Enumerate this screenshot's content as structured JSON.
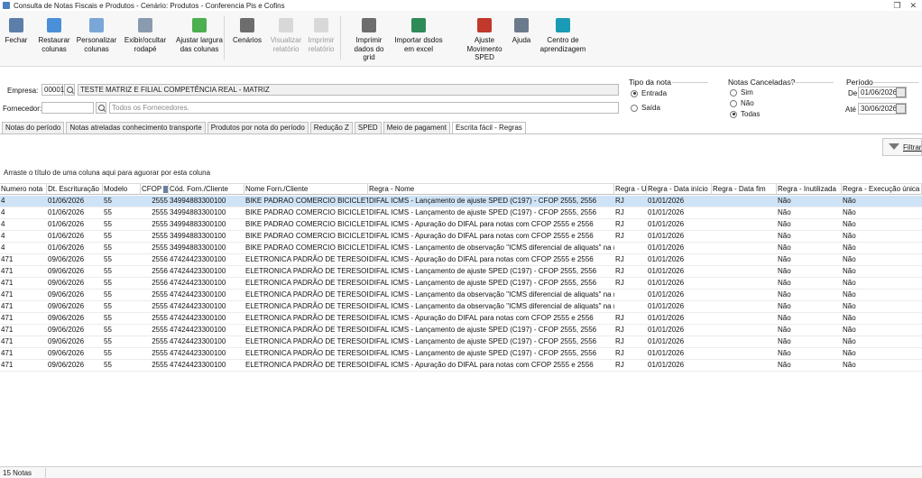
{
  "window": {
    "title": "Consulta de Notas Fiscais e Produtos - Cenário: Produtos - Conferencia Pis e Cofins"
  },
  "toolbar": {
    "buttons": [
      {
        "label": "Fechar",
        "icon": "exit-icon",
        "color": "#5b7fa8"
      },
      {
        "label": "Restaurar\ncolunas",
        "icon": "restore-columns-icon",
        "color": "#4a90d9"
      },
      {
        "label": "Personalizar\ncolunas",
        "icon": "customize-columns-icon",
        "color": "#7aa7d8"
      },
      {
        "label": "Exibir/ocultar\nrodapé",
        "icon": "footer-toggle-icon",
        "color": "#8a9bb0"
      },
      {
        "label": "Ajustar largura\ndas colunas",
        "icon": "column-width-icon",
        "color": "#4caf50"
      },
      {
        "label": "Cenários",
        "icon": "scenarios-icon",
        "color": "#6d6d6d"
      },
      {
        "label": "Visualizar\nrelatório",
        "icon": "preview-report-icon",
        "color": "#9e9e9e"
      },
      {
        "label": "Imprimir\nrelatório",
        "icon": "print-report-icon",
        "color": "#9e9e9e"
      },
      {
        "label": "Imprimir\ndados do grid",
        "icon": "print-grid-icon",
        "color": "#6d6d6d"
      },
      {
        "label": "Importar dsdos\nem excel",
        "icon": "excel-import-icon",
        "color": "#2e8b57"
      },
      {
        "label": "Ajuste\nMovimento SPED",
        "icon": "sped-adjust-icon",
        "color": "#c0392b"
      },
      {
        "label": "Ajuda",
        "icon": "help-icon",
        "color": "#6b7b8c"
      },
      {
        "label": "Centro de\naprendizagem",
        "icon": "learning-center-icon",
        "color": "#1a9bb5"
      }
    ]
  },
  "filters": {
    "empresa_label": "Empresa:",
    "empresa_code": "00001",
    "empresa_name": "TESTE MATRIZ E FILIAL COMPETÊNCIA REAL - MATRIZ",
    "fornecedor_label": "Fornecedor:",
    "fornecedor_code": "",
    "fornecedor_placeholder": "Todos os Fornecedores.",
    "tipo_nota": {
      "title": "Tipo da nota",
      "options": [
        "Entrada",
        "Saída"
      ],
      "selected": "Entrada"
    },
    "notas_canceladas": {
      "title": "Notas Canceladas?",
      "options": [
        "Sim",
        "Não",
        "Todas"
      ],
      "selected": "Todas"
    },
    "periodo": {
      "title": "Período",
      "de_label": "De",
      "de_value": "01/06/2026",
      "ate_label": "Até",
      "ate_value": "30/06/2026"
    }
  },
  "tabs": [
    {
      "label": "Notas do período",
      "active": false
    },
    {
      "label": "Notas atreladas conhecimento transporte",
      "active": false
    },
    {
      "label": "Produtos por nota do período",
      "active": false
    },
    {
      "label": "Redução Z",
      "active": false
    },
    {
      "label": "SPED",
      "active": false
    },
    {
      "label": "Meio de pagament",
      "active": false
    },
    {
      "label": "Escrita fácil - Regras",
      "active": true
    }
  ],
  "filter_button": "Filtrar",
  "group_hint": "Arraste o título de uma coluna aqui para aguorar por esta coluna",
  "grid": {
    "columns": [
      "Numero nota",
      "Dt. Escrituração",
      "Modelo",
      "CFOP",
      "Cód. Forn./Cliente",
      "Nome Forn./Cliente",
      "Regra - Nome",
      "Regra - UF",
      "Regra - Data início",
      "Regra - Data fim",
      "Regra - Inutilizada",
      "Regra - Execução única"
    ],
    "rows": [
      [
        "4",
        "01/06/2026",
        "55",
        "2555",
        "34994883300100",
        "BIKE PADRAO COMERCIO BICICLETAS LTDA",
        "DIFAL ICMS - Lançamento de ajuste SPED (C197) - CFOP 2555, 2556",
        "RJ",
        "01/01/2026",
        "",
        "Não",
        "Não"
      ],
      [
        "4",
        "01/06/2026",
        "55",
        "2555",
        "34994883300100",
        "BIKE PADRAO COMERCIO BICICLETAS LTDA",
        "DIFAL ICMS - Lançamento de ajuste SPED (C197) - CFOP 2555, 2556",
        "RJ",
        "01/01/2026",
        "",
        "Não",
        "Não"
      ],
      [
        "4",
        "01/06/2026",
        "55",
        "2555",
        "34994883300100",
        "BIKE PADRAO COMERCIO BICICLETAS LTDA",
        "DIFAL ICMS - Apuração do DIFAL para notas com CFOP 2555 e 2556",
        "RJ",
        "01/01/2026",
        "",
        "Não",
        "Não"
      ],
      [
        "4",
        "01/06/2026",
        "55",
        "2555",
        "34994883300100",
        "BIKE PADRAO COMERCIO BICICLETAS LTDA",
        "DIFAL ICMS - Apuração do DIFAL para notas com CFOP 2555 e 2556",
        "RJ",
        "01/01/2026",
        "",
        "Não",
        "Não"
      ],
      [
        "4",
        "01/06/2026",
        "55",
        "2555",
        "34994883300100",
        "BIKE PADRAO COMERCIO BICICLETAS LTDA",
        "DIFAL ICMS - Lançamento de observação \"ICMS diferencial de aliquats\" na nota",
        "",
        "01/01/2026",
        "",
        "Não",
        "Não"
      ],
      [
        "471",
        "09/06/2026",
        "55",
        "2556",
        "47424423300100",
        "ELETRONICA PADRÃO DE TERESOPOLIS LTDA",
        "DIFAL ICMS - Apuração do DIFAL para notas com CFOP 2555 e 2556",
        "RJ",
        "01/01/2026",
        "",
        "Não",
        "Não"
      ],
      [
        "471",
        "09/06/2026",
        "55",
        "2556",
        "47424423300100",
        "ELETRONICA PADRÃO DE TERESOPOLIS LTDA",
        "DIFAL ICMS - Lançamento de ajuste SPED (C197) - CFOP 2555, 2556",
        "RJ",
        "01/01/2026",
        "",
        "Não",
        "Não"
      ],
      [
        "471",
        "09/06/2026",
        "55",
        "2556",
        "47424423300100",
        "ELETRONICA PADRÃO DE TERESOPOLIS LTDA",
        "DIFAL ICMS - Lançamento de ajuste SPED (C197) - CFOP 2555, 2556",
        "RJ",
        "01/01/2026",
        "",
        "Não",
        "Não"
      ],
      [
        "471",
        "09/06/2026",
        "55",
        "2555",
        "47424423300100",
        "ELETRONICA PADRÃO DE TERESOPOLIS LTDA",
        "DIFAL ICMS - Lançamento da observação \"ICMS diferencial de aliquats\" na nota",
        "",
        "01/01/2026",
        "",
        "Não",
        "Não"
      ],
      [
        "471",
        "09/06/2026",
        "55",
        "2555",
        "47424423300100",
        "ELETRONICA PADRÃO DE TERESOPOLIS LTDA",
        "DIFAL ICMS - Lançamento da observação \"ICMS diferencial de aliquats\" na nota",
        "",
        "01/01/2026",
        "",
        "Não",
        "Não"
      ],
      [
        "471",
        "09/06/2026",
        "55",
        "2555",
        "47424423300100",
        "ELETRONICA PADRÃO DE TERESOPOLIS LTDA",
        "DIFAL ICMS - Apuração do DIFAL para notas com CFOP 2555 e 2556",
        "RJ",
        "01/01/2026",
        "",
        "Não",
        "Não"
      ],
      [
        "471",
        "09/06/2026",
        "55",
        "2555",
        "47424423300100",
        "ELETRONICA PADRÃO DE TERESOPOLIS LTDA",
        "DIFAL ICMS - Lançamento de ajuste SPED (C197) - CFOP 2555, 2556",
        "RJ",
        "01/01/2026",
        "",
        "Não",
        "Não"
      ],
      [
        "471",
        "09/06/2026",
        "55",
        "2555",
        "47424423300100",
        "ELETRONICA PADRÃO DE TERESOPOLIS LTDA",
        "DIFAL ICMS - Lançamento de ajuste SPED (C197) - CFOP 2555, 2556",
        "RJ",
        "01/01/2026",
        "",
        "Não",
        "Não"
      ],
      [
        "471",
        "09/06/2026",
        "55",
        "2555",
        "47424423300100",
        "ELETRONICA PADRÃO DE TERESOPOLIS LTDA",
        "DIFAL ICMS - Lançamento de ajuste SPED (C197) - CFOP 2555, 2556",
        "RJ",
        "01/01/2026",
        "",
        "Não",
        "Não"
      ],
      [
        "471",
        "09/06/2026",
        "55",
        "2555",
        "47424423300100",
        "ELETRONICA PADRÃO DE TERESOPOLIS LTDA",
        "DIFAL ICMS - Apuração do DIFAL para notas com CFOP 2555 e 2556",
        "RJ",
        "01/01/2026",
        "",
        "Não",
        "Não"
      ]
    ]
  },
  "status": {
    "count_label": "15 Notas"
  }
}
